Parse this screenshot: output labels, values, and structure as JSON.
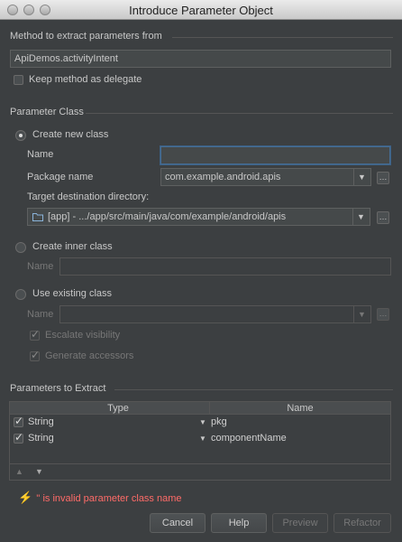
{
  "window": {
    "title": "Introduce Parameter Object"
  },
  "method_section": {
    "label": "Method to extract parameters from",
    "value": "ApiDemos.activityIntent",
    "keep_delegate_label": "Keep method as delegate"
  },
  "param_class_section": {
    "label": "Parameter Class",
    "create_new": {
      "label": "Create new class",
      "name_label": "Name",
      "name_value": "",
      "package_label": "Package name",
      "package_value": "com.example.android.apis",
      "target_label": "Target destination directory:",
      "target_value": "[app] - .../app/src/main/java/com/example/android/apis"
    },
    "create_inner": {
      "label": "Create inner class",
      "name_label": "Name",
      "name_value": ""
    },
    "use_existing": {
      "label": "Use existing class",
      "name_label": "Name",
      "name_value": "",
      "escalate_label": "Escalate visibility",
      "generate_label": "Generate accessors"
    }
  },
  "params_section": {
    "label": "Parameters to Extract",
    "columns": [
      "Type",
      "Name"
    ],
    "rows": [
      {
        "type": "String",
        "name": "pkg"
      },
      {
        "type": "String",
        "name": "componentName"
      }
    ]
  },
  "error": {
    "text": "'' is invalid parameter class name"
  },
  "buttons": {
    "cancel": "Cancel",
    "help": "Help",
    "preview": "Preview",
    "refactor": "Refactor"
  },
  "icons": {
    "combo_arrow": "▼",
    "ellipsis": "…",
    "folder": "folder-icon",
    "error": "lightning-icon",
    "move_up": "▲",
    "move_down": "▼"
  },
  "colors": {
    "background": "#3c3f41",
    "error": "#ff6b68",
    "focus": "#466d94"
  }
}
